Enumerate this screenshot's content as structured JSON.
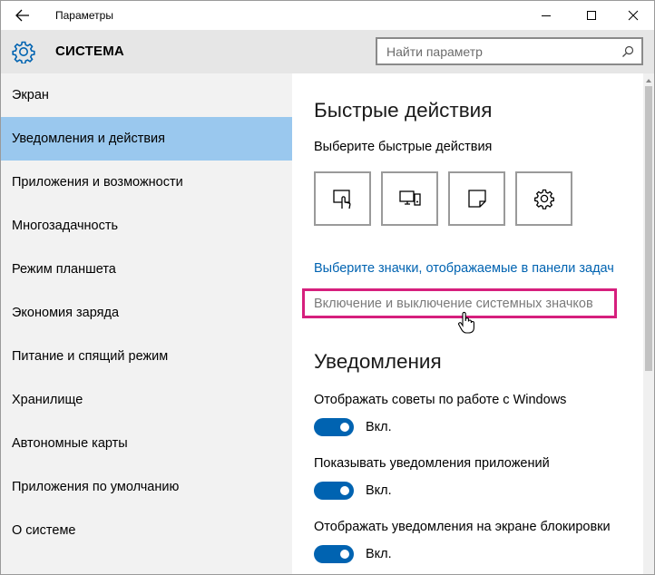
{
  "window": {
    "title": "Параметры",
    "controls": {
      "minimize_icon": "minimize-icon",
      "maximize_icon": "maximize-icon",
      "close_icon": "close-icon"
    }
  },
  "header": {
    "title": "СИСТЕМА",
    "icon": "gear-icon",
    "search": {
      "placeholder": "Найти параметр",
      "icon": "search-icon"
    }
  },
  "sidebar": {
    "active_index": 1,
    "items": [
      {
        "label": "Экран"
      },
      {
        "label": "Уведомления и действия"
      },
      {
        "label": "Приложения и возможности"
      },
      {
        "label": "Многозадачность"
      },
      {
        "label": "Режим планшета"
      },
      {
        "label": "Экономия заряда"
      },
      {
        "label": "Питание и спящий режим"
      },
      {
        "label": "Хранилище"
      },
      {
        "label": "Автономные карты"
      },
      {
        "label": "Приложения по умолчанию"
      },
      {
        "label": "О системе"
      }
    ]
  },
  "main": {
    "quick_actions": {
      "heading": "Быстрые действия",
      "subheading": "Выберите быстрые действия",
      "tiles": [
        {
          "icon": "tablet-mode-icon"
        },
        {
          "icon": "connect-display-icon"
        },
        {
          "icon": "note-icon"
        },
        {
          "icon": "gear-icon"
        }
      ]
    },
    "links": {
      "taskbar_icons": "Выберите значки, отображаемые в панели задач",
      "system_icons": "Включение и выключение системных значков"
    },
    "notifications": {
      "heading": "Уведомления",
      "items": [
        {
          "label": "Отображать советы по работе с Windows",
          "state": "Вкл."
        },
        {
          "label": "Показывать уведомления приложений",
          "state": "Вкл."
        },
        {
          "label": "Отображать уведомления на экране блокировки",
          "state": "Вкл."
        }
      ]
    }
  },
  "colors": {
    "accent": "#0063b1",
    "sidebar_active": "#9ac8ee",
    "highlight_border": "#d61f7d",
    "sidebar_bg": "#f2f2f2",
    "header_bg": "#e6e6e6"
  }
}
